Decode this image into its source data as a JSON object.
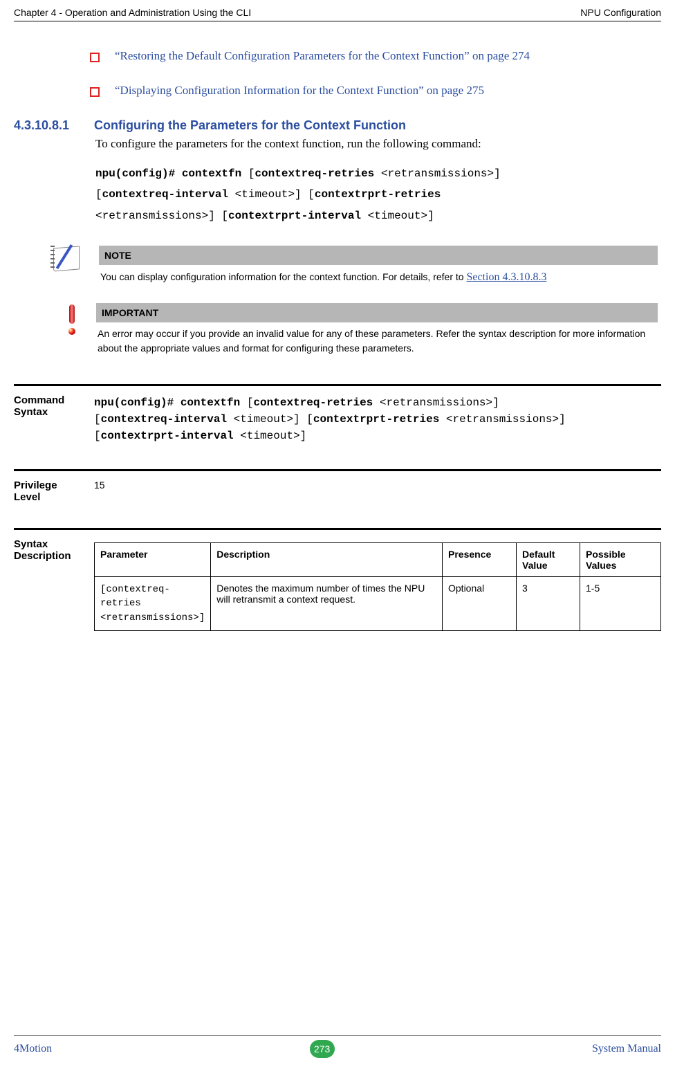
{
  "header": {
    "left": "Chapter 4 - Operation and Administration Using the CLI",
    "right": "NPU Configuration"
  },
  "bullets": [
    "“Restoring the Default Configuration Parameters for the Context Function” on page 274",
    "“Displaying Configuration Information for the Context Function” on page 275"
  ],
  "section": {
    "number": "4.3.10.8.1",
    "title": "Configuring the Parameters for the Context Function",
    "intro": "To configure the parameters for the context function, run the following command:"
  },
  "cmd": {
    "p1_b1": "npu(config)# contextfn ",
    "p1_n1": "[",
    "p1_b2": "contextreq-retries ",
    "p1_n2": "<retransmissions>] ",
    "p2_n1": "[",
    "p2_b1": "contextreq-interval ",
    "p2_n2": "<timeout>] [",
    "p2_b2": "contextrprt-retries ",
    "p3_n1": "<retransmissions>] [",
    "p3_b1": "contextrprt-interval ",
    "p3_n2": "<timeout>]"
  },
  "note": {
    "title": "NOTE",
    "body": "You can display configuration information for the context function. For details, refer to ",
    "link": "Section 4.3.10.8.3"
  },
  "important": {
    "title": "IMPORTANT",
    "body": "An error may occur if you provide an invalid value for any of these parameters. Refer the syntax description for more information about the appropriate values and format for configuring these parameters."
  },
  "blocks": {
    "cmdSyntaxLabel": "Command Syntax",
    "cmdSyntax_b1": "npu(config)# contextfn ",
    "cmdSyntax_n1": "[",
    "cmdSyntax_b2": "contextreq-retries ",
    "cmdSyntax_n2": "<retransmissions>] ",
    "cmdSyntax_n3": "[",
    "cmdSyntax_b3": "contextreq-interval ",
    "cmdSyntax_n4": "<timeout>] [",
    "cmdSyntax_b4": "contextrprt-retries ",
    "cmdSyntax_n5": "<retransmissions>] ",
    "cmdSyntax_n6": "[",
    "cmdSyntax_b5": "contextrprt-interval ",
    "cmdSyntax_n7": "<timeout>]",
    "privLabel": "Privilege Level",
    "privValue": "15",
    "syntaxDescLabel": "Syntax Description"
  },
  "table": {
    "headers": {
      "param": "Parameter",
      "desc": "Description",
      "presence": "Presence",
      "def": "Default Value",
      "vals": "Possible Values"
    },
    "rows": [
      {
        "param": "[contextreq-retries <retransmissions>]",
        "desc": "Denotes the maximum number of times the NPU will retransmit a context request.",
        "presence": "Optional",
        "def": "3",
        "vals": "1-5"
      }
    ]
  },
  "footer": {
    "left": "4Motion",
    "pageno": "273",
    "right": "System Manual"
  }
}
